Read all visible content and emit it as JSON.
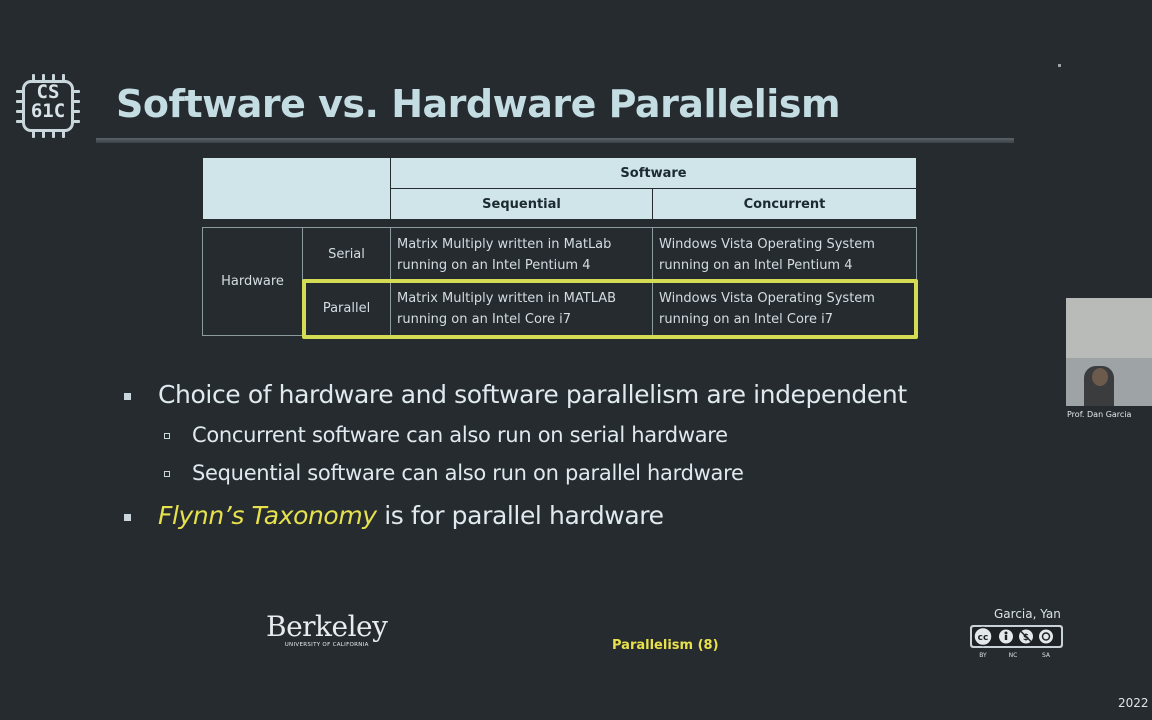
{
  "logo": {
    "line1": "CS",
    "line2": "61C"
  },
  "title": "Software vs. Hardware Parallelism",
  "table": {
    "software_header": "Software",
    "col_sequential": "Sequential",
    "col_concurrent": "Concurrent",
    "hardware_label": "Hardware",
    "rows": [
      {
        "label": "Serial",
        "sequential": [
          "Matrix Multiply written in MatLab",
          "running on an Intel Pentium 4"
        ],
        "concurrent": [
          "Windows Vista Operating System",
          "running on an Intel Pentium 4"
        ]
      },
      {
        "label": "Parallel",
        "sequential": [
          "Matrix Multiply written in MATLAB",
          "running on an Intel Core i7"
        ],
        "concurrent": [
          "Windows Vista Operating System",
          "running on an Intel Core i7"
        ]
      }
    ]
  },
  "bullets": {
    "b1": "Choice of hardware and software parallelism are independent",
    "b1a": "Concurrent software can also run on serial hardware",
    "b1b": "Sequential software can also run on parallel hardware",
    "b2_em": "Flynn’s Taxonomy",
    "b2_rest": " is for parallel hardware"
  },
  "footer": {
    "berkeley_name": "Berkeley",
    "berkeley_sub": "UNIVERSITY OF CALIFORNIA",
    "section": "Parallelism",
    "page": "(8)",
    "credit": "Garcia, Yan",
    "license": [
      "BY",
      "NC",
      "SA"
    ],
    "year": "2022"
  },
  "webcam": {
    "label": "Prof. Dan Garcia"
  },
  "colors": {
    "background": "#262b30",
    "title": "#c3dde3",
    "table_header": "#cfe5ea",
    "highlight": "#d4dc54",
    "emphasis": "#e6e14c"
  }
}
